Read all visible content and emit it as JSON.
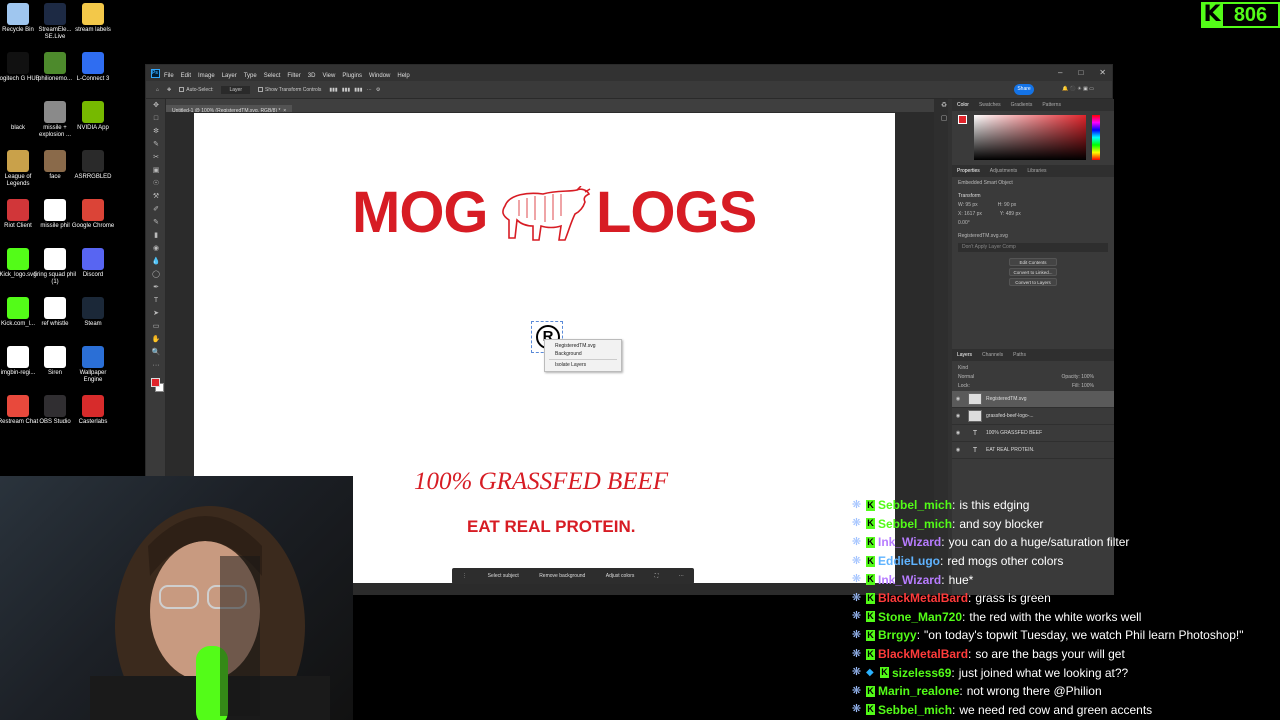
{
  "desktop": {
    "icons": [
      {
        "label": "Recycle Bin",
        "icon": "recycle-bin-icon",
        "color": "#9fc6ef"
      },
      {
        "label": "StreamEle... SE.Live",
        "icon": "streamelements-icon",
        "color": "#1d2a44"
      },
      {
        "label": "stream labels",
        "icon": "folder-icon",
        "color": "#f3c849"
      },
      {
        "label": "Logitech G HUB",
        "icon": "logitech-icon",
        "color": "#111111"
      },
      {
        "label": "philionemo...",
        "icon": "image-file-icon",
        "color": "#4d8a2c"
      },
      {
        "label": "L-Connect 3",
        "icon": "lconnect-icon",
        "color": "#2f6df1"
      },
      {
        "label": "black",
        "icon": "black-image-icon",
        "color": "#000000"
      },
      {
        "label": "missile + explosion ...",
        "icon": "image-file-icon",
        "color": "#8a8a8a"
      },
      {
        "label": "NVIDIA App",
        "icon": "nvidia-icon",
        "color": "#76b900"
      },
      {
        "label": "League of Legends",
        "icon": "league-icon",
        "color": "#c9a14a"
      },
      {
        "label": "face",
        "icon": "face-image-icon",
        "color": "#8a6a4a"
      },
      {
        "label": "ASRRGBLED",
        "icon": "asrock-icon",
        "color": "#2a2a2a"
      },
      {
        "label": "Riot Client",
        "icon": "riot-icon",
        "color": "#d13639"
      },
      {
        "label": "missile phil",
        "icon": "file-icon",
        "color": "#ffffff"
      },
      {
        "label": "Google Chrome",
        "icon": "chrome-icon",
        "color": "#db4437"
      },
      {
        "label": "Kick_logo.svg",
        "icon": "kick-file-icon",
        "color": "#53fc18"
      },
      {
        "label": "firing squad phil (1)",
        "icon": "file-icon",
        "color": "#ffffff"
      },
      {
        "label": "Discord",
        "icon": "discord-icon",
        "color": "#5865f2"
      },
      {
        "label": "Kick.com_l...",
        "icon": "kick-file-icon",
        "color": "#53fc18"
      },
      {
        "label": "ref whistle",
        "icon": "file-icon",
        "color": "#ffffff"
      },
      {
        "label": "Steam",
        "icon": "steam-icon",
        "color": "#1b2838"
      },
      {
        "label": "imgbin-regi...",
        "icon": "registered-file-icon",
        "color": "#ffffff"
      },
      {
        "label": "Siren",
        "icon": "file-icon",
        "color": "#ffffff"
      },
      {
        "label": "Wallpaper Engine",
        "icon": "wallpaper-engine-icon",
        "color": "#2b6fd6"
      },
      {
        "label": "Restream Chat",
        "icon": "restream-icon",
        "color": "#e8493c"
      },
      {
        "label": "OBS Studio",
        "icon": "obs-icon",
        "color": "#302e31"
      },
      {
        "label": "Casterlabs",
        "icon": "casterlabs-icon",
        "color": "#d72b2b"
      }
    ]
  },
  "kick_counter": {
    "logo": "K",
    "value": "806",
    "color": "#53fc18"
  },
  "photoshop": {
    "menu": [
      "File",
      "Edit",
      "Image",
      "Layer",
      "Type",
      "Select",
      "Filter",
      "3D",
      "View",
      "Plugins",
      "Window",
      "Help"
    ],
    "options": {
      "auto_select": "Auto-Select:",
      "auto_select_value": "Layer",
      "transform_controls": "Show Transform Controls"
    },
    "share_label": "Share",
    "document_tab": "Untitled-1 @ 100% (RegisteredTM.svg, RGB/8) *",
    "canvas": {
      "logo_left": "MOG",
      "logo_right": "LOGS",
      "tagline": "100% GRASSFED BEEF",
      "protein": "EAT REAL PROTEIN.",
      "brand_red": "#d71c24"
    },
    "context_menu": [
      "RegisteredTM.svg",
      "Background",
      "Isolate Layers"
    ],
    "contextual_taskbar": [
      "Select subject",
      "Remove background",
      "Adjust colors"
    ],
    "color_panel": {
      "tabs": [
        "Color",
        "Swatches",
        "Gradients",
        "Patterns"
      ],
      "foreground": "#e0242b"
    },
    "properties_panel": {
      "tabs": [
        "Properties",
        "Adjustments",
        "Libraries"
      ],
      "type": "Embedded Smart Object",
      "section": "Transform",
      "w": "W: 95 px",
      "h": "H: 90 px",
      "x": "X: 1617 px",
      "y": "Y: 489 px",
      "angle": "0.00°",
      "file": "RegisteredTM.svg.svg",
      "comps": "Don't Apply Layer Comp",
      "buttons": [
        "Edit Contents",
        "Convert to Linked...",
        "Convert to Layers"
      ]
    },
    "layers_panel": {
      "tabs": [
        "Layers",
        "Channels",
        "Paths"
      ],
      "filter": "Kind",
      "blend": "Normal",
      "opacity": "Opacity: 100%",
      "fill": "Fill: 100%",
      "lock": "Lock:",
      "layers": [
        {
          "name": "RegisteredTM.svg",
          "kind": "smart",
          "selected": true
        },
        {
          "name": "grassfed-beef-logo-...",
          "kind": "smart",
          "selected": false
        },
        {
          "name": "100% GRASSFED BEEF",
          "kind": "text",
          "selected": false
        },
        {
          "name": "EAT REAL PROTEIN.",
          "kind": "text",
          "selected": false
        }
      ]
    }
  },
  "chat": {
    "messages": [
      {
        "user": "Sebbel_mich",
        "color": "#53fc18",
        "text": "is this edging",
        "badges": 2
      },
      {
        "user": "Sebbel_mich",
        "color": "#53fc18",
        "text": "and soy blocker",
        "badges": 2
      },
      {
        "user": "Ink_Wizard",
        "color": "#b77cff",
        "text": "you can do a huge/saturation filter",
        "badges": 2
      },
      {
        "user": "EddieLugo",
        "color": "#5fb3ff",
        "text": "red mogs other colors",
        "badges": 2
      },
      {
        "user": "Ink_Wizard",
        "color": "#b77cff",
        "text": "hue*",
        "badges": 2
      },
      {
        "user": "BlackMetalBard",
        "color": "#ff3b3b",
        "text": "grass is green",
        "badges": 2
      },
      {
        "user": "Stone_Man720",
        "color": "#53fc18",
        "text": "the red with the white works well",
        "badges": 2
      },
      {
        "user": "Brrgyy",
        "color": "#53fc18",
        "text": "\"on today's topwit Tuesday, we watch Phil learn Photoshop!\"",
        "badges": 2
      },
      {
        "user": "BlackMetalBard",
        "color": "#ff3b3b",
        "text": "so are the bags your will get",
        "badges": 2
      },
      {
        "user": "sizeless69",
        "color": "#53fc18",
        "text": "just joined what we looking at??",
        "badges": 3
      },
      {
        "user": "Marin_realone",
        "color": "#53fc18",
        "text": "not wrong there @Philion",
        "badges": 2
      },
      {
        "user": "Sebbel_mich",
        "color": "#53fc18",
        "text": "we need red cow and green accents",
        "badges": 2
      }
    ]
  }
}
